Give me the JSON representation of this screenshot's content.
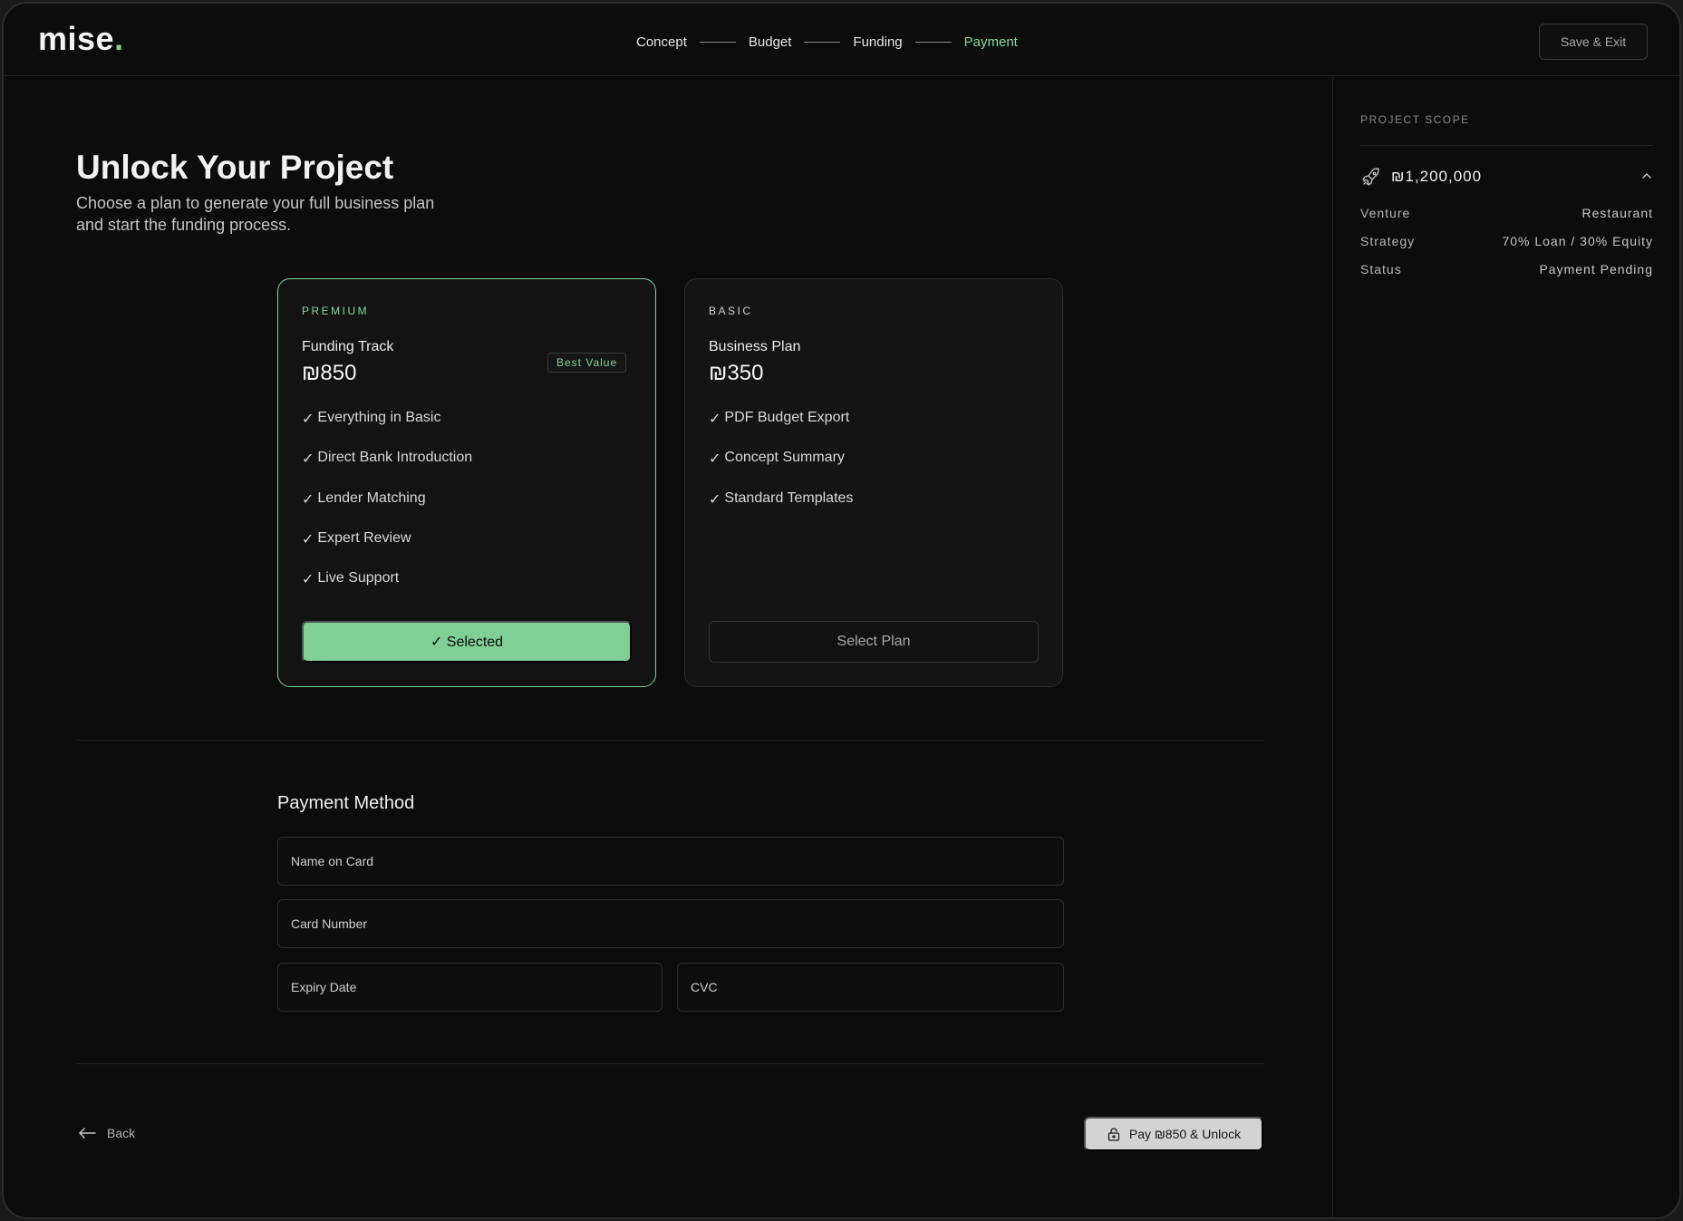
{
  "header": {
    "logo_text": "mise",
    "logo_dot": ".",
    "steps": [
      "Concept",
      "Budget",
      "Funding",
      "Payment"
    ],
    "active_step": "Payment",
    "save_exit_label": "Save & Exit"
  },
  "sidebar": {
    "label": "PROJECT SCOPE",
    "amount": "₪1,200,000",
    "rows": [
      {
        "key": "Venture",
        "value": "Restaurant"
      },
      {
        "key": "Strategy",
        "value": "70% Loan / 30% Equity"
      },
      {
        "key": "Status",
        "value": "Payment Pending"
      }
    ]
  },
  "main": {
    "title_light": "Unlock ",
    "title_bold": "Your Project",
    "subtitle": "Choose a plan to generate your full business plan and start the funding process."
  },
  "plans": {
    "premium": {
      "tier": "PREMIUM",
      "name": "Funding Track",
      "price": "₪850",
      "badge": "Best Value",
      "features": [
        "Everything in Basic",
        "Direct Bank Introduction",
        "Lender Matching",
        "Expert Review",
        "Live Support"
      ],
      "button": "✓ Selected"
    },
    "basic": {
      "tier": "BASIC",
      "name": "Business Plan",
      "price": "₪350",
      "features": [
        "PDF Budget Export",
        "Concept Summary",
        "Standard Templates"
      ],
      "button": "Select Plan"
    }
  },
  "payment": {
    "title": "Payment Method",
    "name_placeholder": "Name on Card",
    "card_placeholder": "Card Number",
    "expiry_placeholder": "Expiry Date",
    "cvc_placeholder": "CVC"
  },
  "footer": {
    "back_label": "Back",
    "pay_label": "Pay ₪850 & Unlock"
  },
  "colors": {
    "accent": "#80cf96",
    "background": "#0c0c0c"
  }
}
